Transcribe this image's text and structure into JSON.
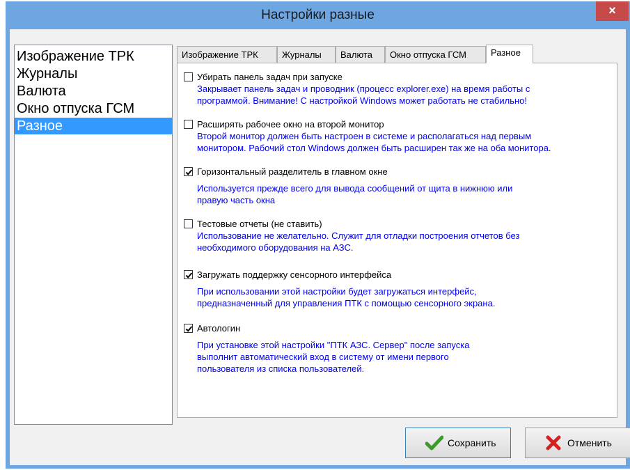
{
  "window": {
    "title": "Настройки разные",
    "close_glyph": "×"
  },
  "sidebar": {
    "items": [
      {
        "label": "Изображение ТРК"
      },
      {
        "label": "Журналы"
      },
      {
        "label": "Валюта"
      },
      {
        "label": "Окно отпуска ГСМ"
      },
      {
        "label": "Разное",
        "selected": true
      }
    ]
  },
  "tabs": [
    {
      "label": "Изображение ТРК"
    },
    {
      "label": "Журналы"
    },
    {
      "label": "Валюта"
    },
    {
      "label": "Окно отпуска ГСМ"
    },
    {
      "label": "Разное",
      "active": true
    }
  ],
  "options": [
    {
      "label": "Убирать панель задач при запуске",
      "checked": false,
      "desc": [
        "Закрывает панель задач и проводник (процесс explorer.exe) на время работы с",
        "программой. Внимание! С настройкой Windows может работать не стабильно!"
      ]
    },
    {
      "label": "Расширять рабочее окно на второй монитор",
      "checked": false,
      "desc": [
        "Второй монитор должен быть настроен в системе и располагаться над первым",
        "монитором. Рабочий стол Windows должен быть расширен так же на оба монитора."
      ]
    },
    {
      "label": "Горизонтальный разделитель в главном окне",
      "checked": true,
      "desc": [
        "Используется прежде всего для вывода сообщений от щита в нижнюю или",
        "правую часть окна"
      ]
    },
    {
      "label": "Тестовые отчеты (не ставить)",
      "checked": false,
      "desc": [
        "Использование не желательно. Служит для отладки построения отчетов без",
        "необходимого оборудования на АЗС."
      ]
    },
    {
      "label": "Загружать поддержку сенсорного интерфейса",
      "checked": true,
      "desc": [
        "При использовании этой настройки будет загружаться интерфейс,",
        "предназначенный для управления ПТК с помощью сенсорного экрана."
      ]
    },
    {
      "label": "Автологин",
      "checked": true,
      "desc": [
        "При установке этой настройки \"ПТК АЗС. Сервер\" после запуска",
        "выполнит автоматический вход в систему от имени первого",
        "пользователя из списка пользователей."
      ]
    }
  ],
  "buttons": {
    "save": {
      "label": "Сохранить",
      "icon": "checkmark-icon"
    },
    "cancel": {
      "label": "Отменить",
      "icon": "cross-icon"
    }
  },
  "colors": {
    "titlebar": "#6ea6e2",
    "selection": "#3399ff",
    "description_text": "#0000ee",
    "close_button": "#c74a4a"
  }
}
